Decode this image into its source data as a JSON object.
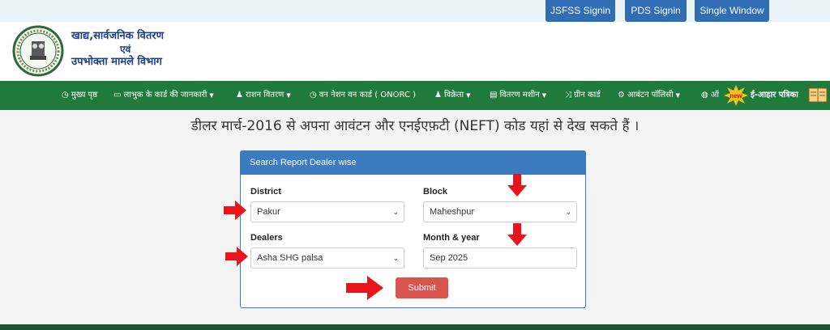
{
  "topbar": {
    "buttons": [
      "JSFSS Signin",
      "PDS Signin",
      "Single Window"
    ]
  },
  "header": {
    "logo_line1": "खाद्य,सार्वजनिक वितरण",
    "logo_line2": "एवं",
    "logo_line3": "उपभोक्ता मामले विभाग",
    "emblem_icon": "state-emblem-icon"
  },
  "nav": {
    "items": [
      {
        "icon": "clock-icon",
        "label": "मुख्य पृष्ठ"
      },
      {
        "icon": "card-icon",
        "label": "लाभुक के कार्ड की जानकारी"
      },
      {
        "icon": "user-icon",
        "label": "राशन वितरण"
      },
      {
        "icon": "clock-icon",
        "label": "वन नेशन वन कार्ड ( ONORC )"
      },
      {
        "icon": "user-icon",
        "label": "विक्रेता"
      },
      {
        "icon": "machine-icon",
        "label": "वितरण मशीन"
      },
      {
        "icon": "shuffle-icon",
        "label": "ग्रीन कार्ड"
      },
      {
        "icon": "gear-icon",
        "label": "आबंटन पॉलिसी"
      },
      {
        "icon": "globe-icon",
        "label": "ऑ"
      },
      {
        "icon": "",
        "label": "ई-आहार पत्रिका"
      }
    ],
    "new_badge": "new"
  },
  "page_heading": "डीलर मार्च-2016 से अपना आवंटन और एनईएफ़टी (NEFT) कोड यहां से देख सकते हैं ।",
  "panel": {
    "title": "Search Report Dealer wise",
    "district_label": "District",
    "district_value": "Pakur",
    "block_label": "Block",
    "block_value": "Maheshpur",
    "dealers_label": "Dealers",
    "dealers_value": "Asha SHG palsa",
    "month_label": "Month & year",
    "month_value": "Sep 2025",
    "submit_label": "Submit"
  },
  "colors": {
    "nav_green": "#1f7a3b",
    "topbtn_blue": "#2f6db5",
    "panel_blue": "#3b7bbf",
    "submit_red": "#d9534f",
    "arrow_red": "#e8141a"
  }
}
